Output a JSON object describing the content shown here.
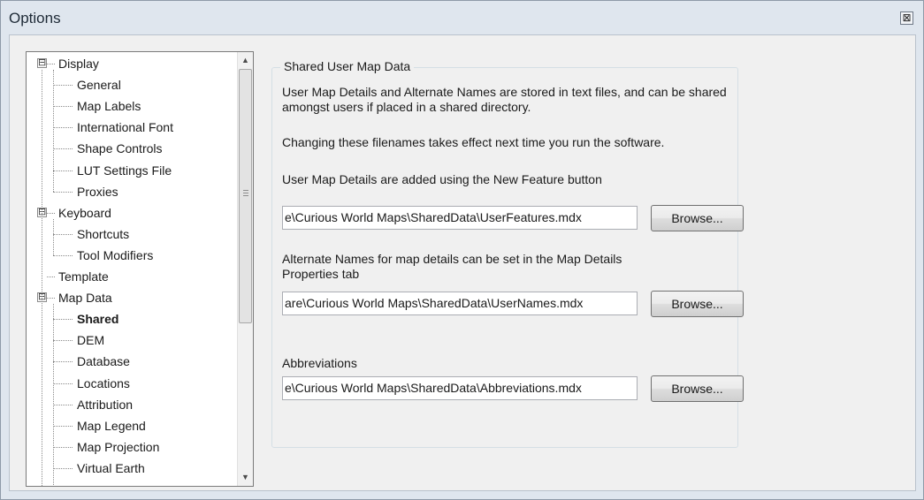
{
  "window": {
    "title": "Options",
    "close_glyph": "⊠"
  },
  "tree": {
    "items": [
      {
        "label": "Display",
        "level": 0,
        "expander": "⊟"
      },
      {
        "label": "General",
        "level": 1
      },
      {
        "label": "Map Labels",
        "level": 1
      },
      {
        "label": "International Font",
        "level": 1
      },
      {
        "label": "Shape Controls",
        "level": 1
      },
      {
        "label": "LUT Settings File",
        "level": 1
      },
      {
        "label": "Proxies",
        "level": 1
      },
      {
        "label": "Keyboard",
        "level": 0,
        "expander": "⊟"
      },
      {
        "label": "Shortcuts",
        "level": 1
      },
      {
        "label": "Tool Modifiers",
        "level": 1
      },
      {
        "label": "Template",
        "level": 0
      },
      {
        "label": "Map Data",
        "level": 0,
        "expander": "⊟"
      },
      {
        "label": "Shared",
        "level": 1,
        "selected": true
      },
      {
        "label": "DEM",
        "level": 1
      },
      {
        "label": "Database",
        "level": 1
      },
      {
        "label": "Locations",
        "level": 1
      },
      {
        "label": "Attribution",
        "level": 1
      },
      {
        "label": "Map Legend",
        "level": 1
      },
      {
        "label": "Map Projection",
        "level": 1
      },
      {
        "label": "Virtual Earth",
        "level": 1
      }
    ],
    "scroll_up_glyph": "▲",
    "scroll_down_glyph": "▼"
  },
  "shared": {
    "group_title": "Shared User Map Data",
    "intro": "User Map Details and Alternate Names are stored in text files, and can be shared amongst users if placed in a shared directory.",
    "restart_note": "Changing these filenames takes effect next time you run the software.",
    "user_features_label": "User Map Details are added using the New Feature button",
    "user_features_path": "e\\Curious World Maps\\SharedData\\UserFeatures.mdx",
    "alt_names_label": "Alternate Names for map details can be set in the Map Details Properties tab",
    "alt_names_path": "are\\Curious World Maps\\SharedData\\UserNames.mdx",
    "abbrev_label": "Abbreviations",
    "abbrev_path": "e\\Curious World Maps\\SharedData\\Abbreviations.mdx",
    "browse_label": "Browse..."
  }
}
